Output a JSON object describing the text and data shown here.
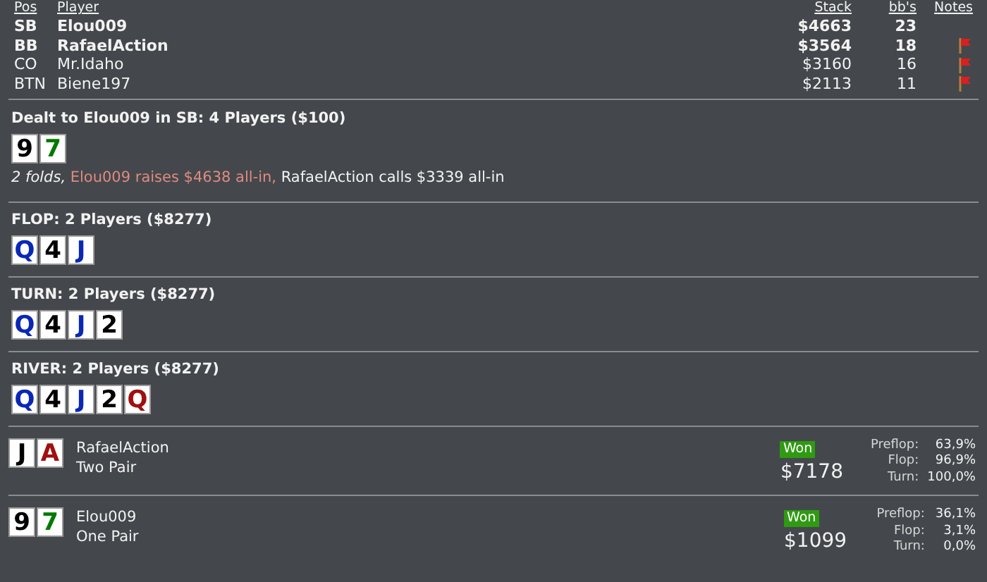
{
  "players_table": {
    "columns": [
      "Pos",
      "Player",
      "Stack",
      "bb's",
      "Notes"
    ],
    "rows": [
      {
        "pos": "SB",
        "player": "Elou009",
        "stack": "$4663",
        "bbs": "23",
        "highlighted": true,
        "note": false
      },
      {
        "pos": "BB",
        "player": "RafaelAction",
        "stack": "$3564",
        "bbs": "18",
        "highlighted": true,
        "note": true
      },
      {
        "pos": "CO",
        "player": "Mr.Idaho",
        "stack": "$3160",
        "bbs": "16",
        "highlighted": false,
        "note": true
      },
      {
        "pos": "BTN",
        "player": "Biene197",
        "stack": "$2113",
        "bbs": "11",
        "highlighted": false,
        "note": true
      }
    ]
  },
  "streets": [
    {
      "title": "Dealt to Elou009 in SB: 4 Players ($100)",
      "cards": [
        {
          "rank": "9",
          "color": "#000000"
        },
        {
          "rank": "7",
          "color": "#007a00"
        }
      ],
      "actions": [
        {
          "kind": "fold",
          "text": "2 folds,"
        },
        {
          "kind": "raise",
          "text": "Elou009 raises $4638 all-in,"
        },
        {
          "kind": "call",
          "text": "RafaelAction calls $3339 all-in"
        }
      ]
    },
    {
      "title": "FLOP: 2 Players ($8277)",
      "cards": [
        {
          "rank": "Q",
          "color": "#0a28b4"
        },
        {
          "rank": "4",
          "color": "#000000"
        },
        {
          "rank": "J",
          "color": "#0a28b4"
        }
      ]
    },
    {
      "title": "TURN: 2 Players ($8277)",
      "cards": [
        {
          "rank": "Q",
          "color": "#0a28b4"
        },
        {
          "rank": "4",
          "color": "#000000"
        },
        {
          "rank": "J",
          "color": "#0a28b4"
        },
        {
          "rank": "2",
          "color": "#000000"
        }
      ]
    },
    {
      "title": "RIVER: 2 Players ($8277)",
      "cards": [
        {
          "rank": "Q",
          "color": "#0a28b4"
        },
        {
          "rank": "4",
          "color": "#000000"
        },
        {
          "rank": "J",
          "color": "#0a28b4"
        },
        {
          "rank": "2",
          "color": "#000000"
        },
        {
          "rank": "Q",
          "color": "#a01010"
        }
      ]
    }
  ],
  "results": [
    {
      "cards": [
        {
          "rank": "J",
          "color": "#000000"
        },
        {
          "rank": "A",
          "color": "#a01010"
        }
      ],
      "player": "RafaelAction",
      "hand": "Two Pair",
      "badge": "Won",
      "amount": "$7178",
      "equity": [
        {
          "label": "Preflop:",
          "value": "63,9%"
        },
        {
          "label": "Flop:",
          "value": "96,9%"
        },
        {
          "label": "Turn:",
          "value": "100,0%"
        }
      ]
    },
    {
      "cards": [
        {
          "rank": "9",
          "color": "#000000"
        },
        {
          "rank": "7",
          "color": "#007a00"
        }
      ],
      "player": "Elou009",
      "hand": "One Pair",
      "badge": "Won",
      "amount": "$1099",
      "equity": [
        {
          "label": "Preflop:",
          "value": "36,1%"
        },
        {
          "label": "Flop:",
          "value": "3,1%"
        },
        {
          "label": "Turn:",
          "value": "0,0%"
        }
      ]
    }
  ]
}
